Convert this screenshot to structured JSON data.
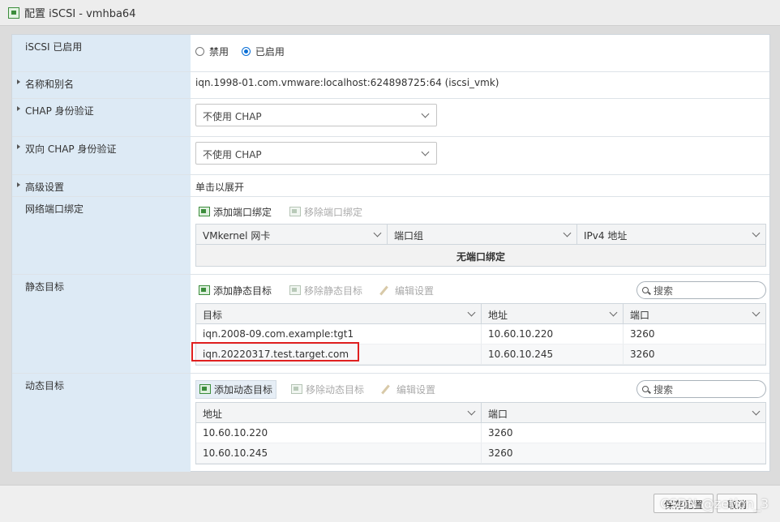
{
  "window": {
    "title": "配置 iSCSI - vmhba64"
  },
  "iscsi_enable": {
    "label": "iSCSI 已启用",
    "options": [
      "禁用",
      "已启用"
    ],
    "selected": "已启用"
  },
  "name_alias": {
    "label": "名称和别名",
    "value": "iqn.1998-01.com.vmware:localhost:624898725:64 (iscsi_vmk)"
  },
  "chap": {
    "label": "CHAP 身份验证",
    "value": "不使用 CHAP"
  },
  "mutual_chap": {
    "label": "双向 CHAP 身份验证",
    "value": "不使用 CHAP"
  },
  "advanced": {
    "label": "高级设置",
    "value": "单击以展开"
  },
  "port_binding": {
    "label": "网络端口绑定",
    "add": "添加端口绑定",
    "remove": "移除端口绑定",
    "columns": [
      "VMkernel 网卡",
      "端口组",
      "IPv4 地址"
    ],
    "empty": "无端口绑定"
  },
  "static_targets": {
    "label": "静态目标",
    "add": "添加静态目标",
    "remove": "移除静态目标",
    "edit": "编辑设置",
    "search_placeholder": "搜索",
    "columns": [
      "目标",
      "地址",
      "端口"
    ],
    "rows": [
      [
        "iqn.2008-09.com.example:tgt1",
        "10.60.10.220",
        "3260"
      ],
      [
        "iqn.20220317.test.target.com",
        "10.60.10.245",
        "3260"
      ]
    ]
  },
  "dynamic_targets": {
    "label": "动态目标",
    "add": "添加动态目标",
    "remove": "移除动态目标",
    "edit": "编辑设置",
    "search_placeholder": "搜索",
    "columns": [
      "地址",
      "端口"
    ],
    "rows": [
      [
        "10.60.10.220",
        "3260"
      ],
      [
        "10.60.10.245",
        "3260"
      ]
    ]
  },
  "footer": {
    "save": "保存配置",
    "cancel": "取消"
  },
  "watermark": "CSDN @zetion_3",
  "colors": {
    "label_bg": "#ddeaf5",
    "radio_selected": "#0a6fd6",
    "highlight": "#e02020"
  }
}
